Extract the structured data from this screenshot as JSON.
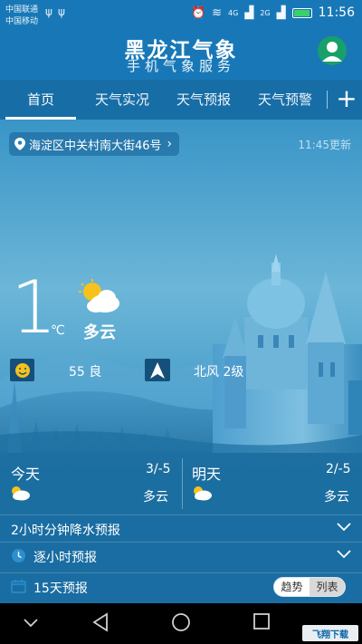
{
  "status_bar": {
    "carrier_line1": "中国联通",
    "carrier_line2": "中国移动",
    "signal_4g": "4G",
    "signal_2g": "2G",
    "time": "11:56"
  },
  "header": {
    "title": "黑龙江气象",
    "subtitle": "手机气象服务"
  },
  "tabs": [
    {
      "label": "首页",
      "active": true
    },
    {
      "label": "天气实况",
      "active": false
    },
    {
      "label": "天气预报",
      "active": false
    },
    {
      "label": "天气预警",
      "active": false
    }
  ],
  "add_label": "+",
  "location": {
    "address": "海淀区中关村南大街46号",
    "update_time": "11:45更新"
  },
  "current": {
    "temperature": "1",
    "unit": "℃",
    "condition": "多云",
    "aqi": "55 良",
    "wind": "北风 2级"
  },
  "forecast": {
    "today": {
      "label": "今天",
      "temp": "3/-5",
      "condition": "多云"
    },
    "tomorrow": {
      "label": "明天",
      "temp": "2/-5",
      "condition": "多云"
    }
  },
  "rows": {
    "precip": "2小时分钟降水预报",
    "hourly": "逐小时预报",
    "fifteen_day": "15天预报",
    "toggle_trend": "趋势",
    "toggle_list": "列表"
  },
  "watermark": "飞翔下载",
  "colors": {
    "header_bg": "#1878b7",
    "tab_bg": "#176da6",
    "avatar_bg": "#18a06a",
    "battery": "#3ad16b"
  }
}
